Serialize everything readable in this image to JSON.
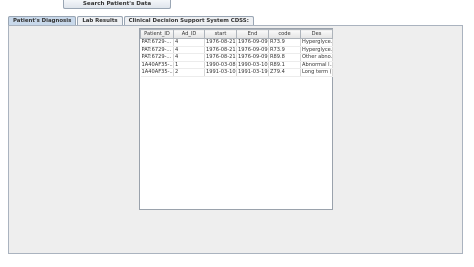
{
  "toolbar": {
    "search_label": "Search Patient's Data"
  },
  "tabs": [
    {
      "label": "Patient's Diagnosis",
      "active": true
    },
    {
      "label": "Lab Results",
      "active": false
    },
    {
      "label": "Clinical Decision Support System CDSS:",
      "active": false
    }
  ],
  "table": {
    "headers": [
      "Patient_ID",
      "Ad_ID",
      "start",
      "End",
      "code",
      "Des"
    ],
    "rows": [
      [
        "PAT:6729-...",
        "4",
        "1976-08-21",
        "1976-09-09",
        "R73.9",
        "Hyperglyce..."
      ],
      [
        "PAT:6729-...",
        "4",
        "1976-08-21",
        "1976-09-09",
        "R73.9",
        "Hyperglyce..."
      ],
      [
        "PAT:6729-...",
        "4",
        "1976-08-21",
        "1976-09-09",
        "R89.8",
        "Other abno..."
      ],
      [
        "1A40AF35-...",
        "1",
        "1990-03-08",
        "1990-03-10",
        "R89.1",
        "Abnormal l..."
      ],
      [
        "1A40AF35-...",
        "2",
        "1991-03-10",
        "1991-03-19",
        "Z79.4",
        "Long term (..."
      ]
    ]
  }
}
